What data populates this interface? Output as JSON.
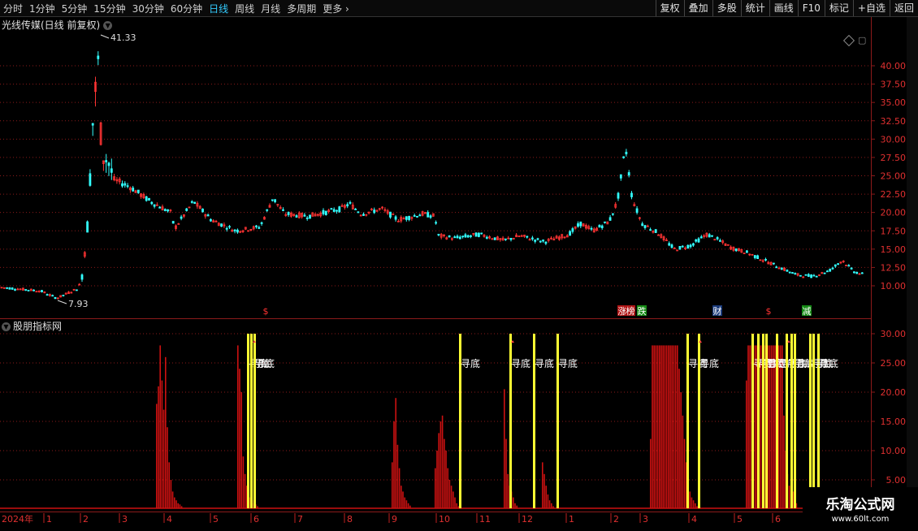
{
  "toolbar": {
    "periods": [
      "分时",
      "1分钟",
      "5分钟",
      "15分钟",
      "30分钟",
      "60分钟",
      "日线",
      "周线",
      "月线",
      "多周期"
    ],
    "active": "日线",
    "more": "更多",
    "right": [
      "复权",
      "叠加",
      "多股",
      "统计",
      "画线",
      "F10",
      "标记",
      "+自选",
      "返回"
    ]
  },
  "main_panel": {
    "title": "光线传媒(日线 前复权)",
    "high_label": "41.33",
    "low_label": "7.93",
    "y_ticks": [
      "40.00",
      "37.50",
      "35.00",
      "32.50",
      "30.00",
      "27.50",
      "25.00",
      "22.50",
      "20.00",
      "17.50",
      "15.00",
      "12.50",
      "10.00"
    ],
    "event_markers": [
      {
        "text": "$",
        "color": "#ff3333"
      },
      {
        "text": "涨",
        "color": "#ffffff",
        "bg": "#b01515"
      },
      {
        "text": "榜",
        "color": "#ffffff",
        "bg": "#b01515"
      },
      {
        "text": "跌",
        "color": "#ffffff",
        "bg": "#158a15"
      },
      {
        "text": "财",
        "color": "#ffffff",
        "bg": "#1a3a7a"
      },
      {
        "text": "$",
        "color": "#ff3333"
      },
      {
        "text": "减",
        "color": "#ffffff",
        "bg": "#158a15"
      }
    ]
  },
  "indicator_panel": {
    "title": "股朋指标网",
    "y_ticks": [
      "30.00",
      "25.00",
      "20.00",
      "15.00",
      "10.00",
      "5.00"
    ],
    "signal_label": "寻底",
    "signal_color": "#ffff33"
  },
  "x_axis": {
    "year_label": "2024年",
    "months": [
      "1",
      "2",
      "3",
      "4",
      "5",
      "6",
      "7",
      "8",
      "9",
      "10",
      "11",
      "12",
      "1",
      "2",
      "3",
      "4",
      "5",
      "6"
    ]
  },
  "watermark": {
    "title": "乐淘公式网",
    "url": "www.60lt.com"
  },
  "colors": {
    "up": "#ff3333",
    "down": "#33ffff",
    "bar": "#cc1111",
    "signal": "#ffff33",
    "grid": "#8b1a1a"
  },
  "chart_data": [
    {
      "type": "candlestick",
      "title": "光线传媒(日线 前复权)",
      "ylim": [
        8.0,
        42.0
      ],
      "y_ticks": [
        10.0,
        12.5,
        15.0,
        17.5,
        20.0,
        22.5,
        25.0,
        27.5,
        30.0,
        32.5,
        35.0,
        37.5,
        40.0
      ],
      "x": [
        "2024-01",
        "2024-02",
        "2024-03",
        "2024-04",
        "2024-05",
        "2024-06",
        "2024-07",
        "2024-08",
        "2024-09",
        "2024-10",
        "2024-11",
        "2024-12",
        "2025-01",
        "2025-02",
        "2025-03",
        "2025-04",
        "2025-05",
        "2025-06"
      ],
      "close_approx": [
        9.8,
        9.0,
        23.0,
        20.0,
        19.3,
        20.5,
        19.8,
        20.5,
        20.0,
        16.5,
        17.0,
        16.2,
        17.0,
        22.0,
        17.5,
        16.0,
        13.0,
        12.0
      ],
      "max": 41.33,
      "min": 7.93
    },
    {
      "type": "bar",
      "title": "股朋指标网",
      "ylim": [
        0,
        32
      ],
      "y_ticks": [
        5.0,
        10.0,
        15.0,
        20.0,
        25.0,
        30.0
      ],
      "clusters": [
        {
          "peak": 28.2
        },
        {
          "peak": 28.2
        },
        {
          "peak": 19.0
        },
        {
          "peak": 16.0
        },
        {
          "peak": 20.5
        },
        {
          "peak": 8.0
        },
        {
          "peak": 28.2
        },
        {
          "peak": 28.2
        }
      ],
      "signals_count": 20
    }
  ]
}
